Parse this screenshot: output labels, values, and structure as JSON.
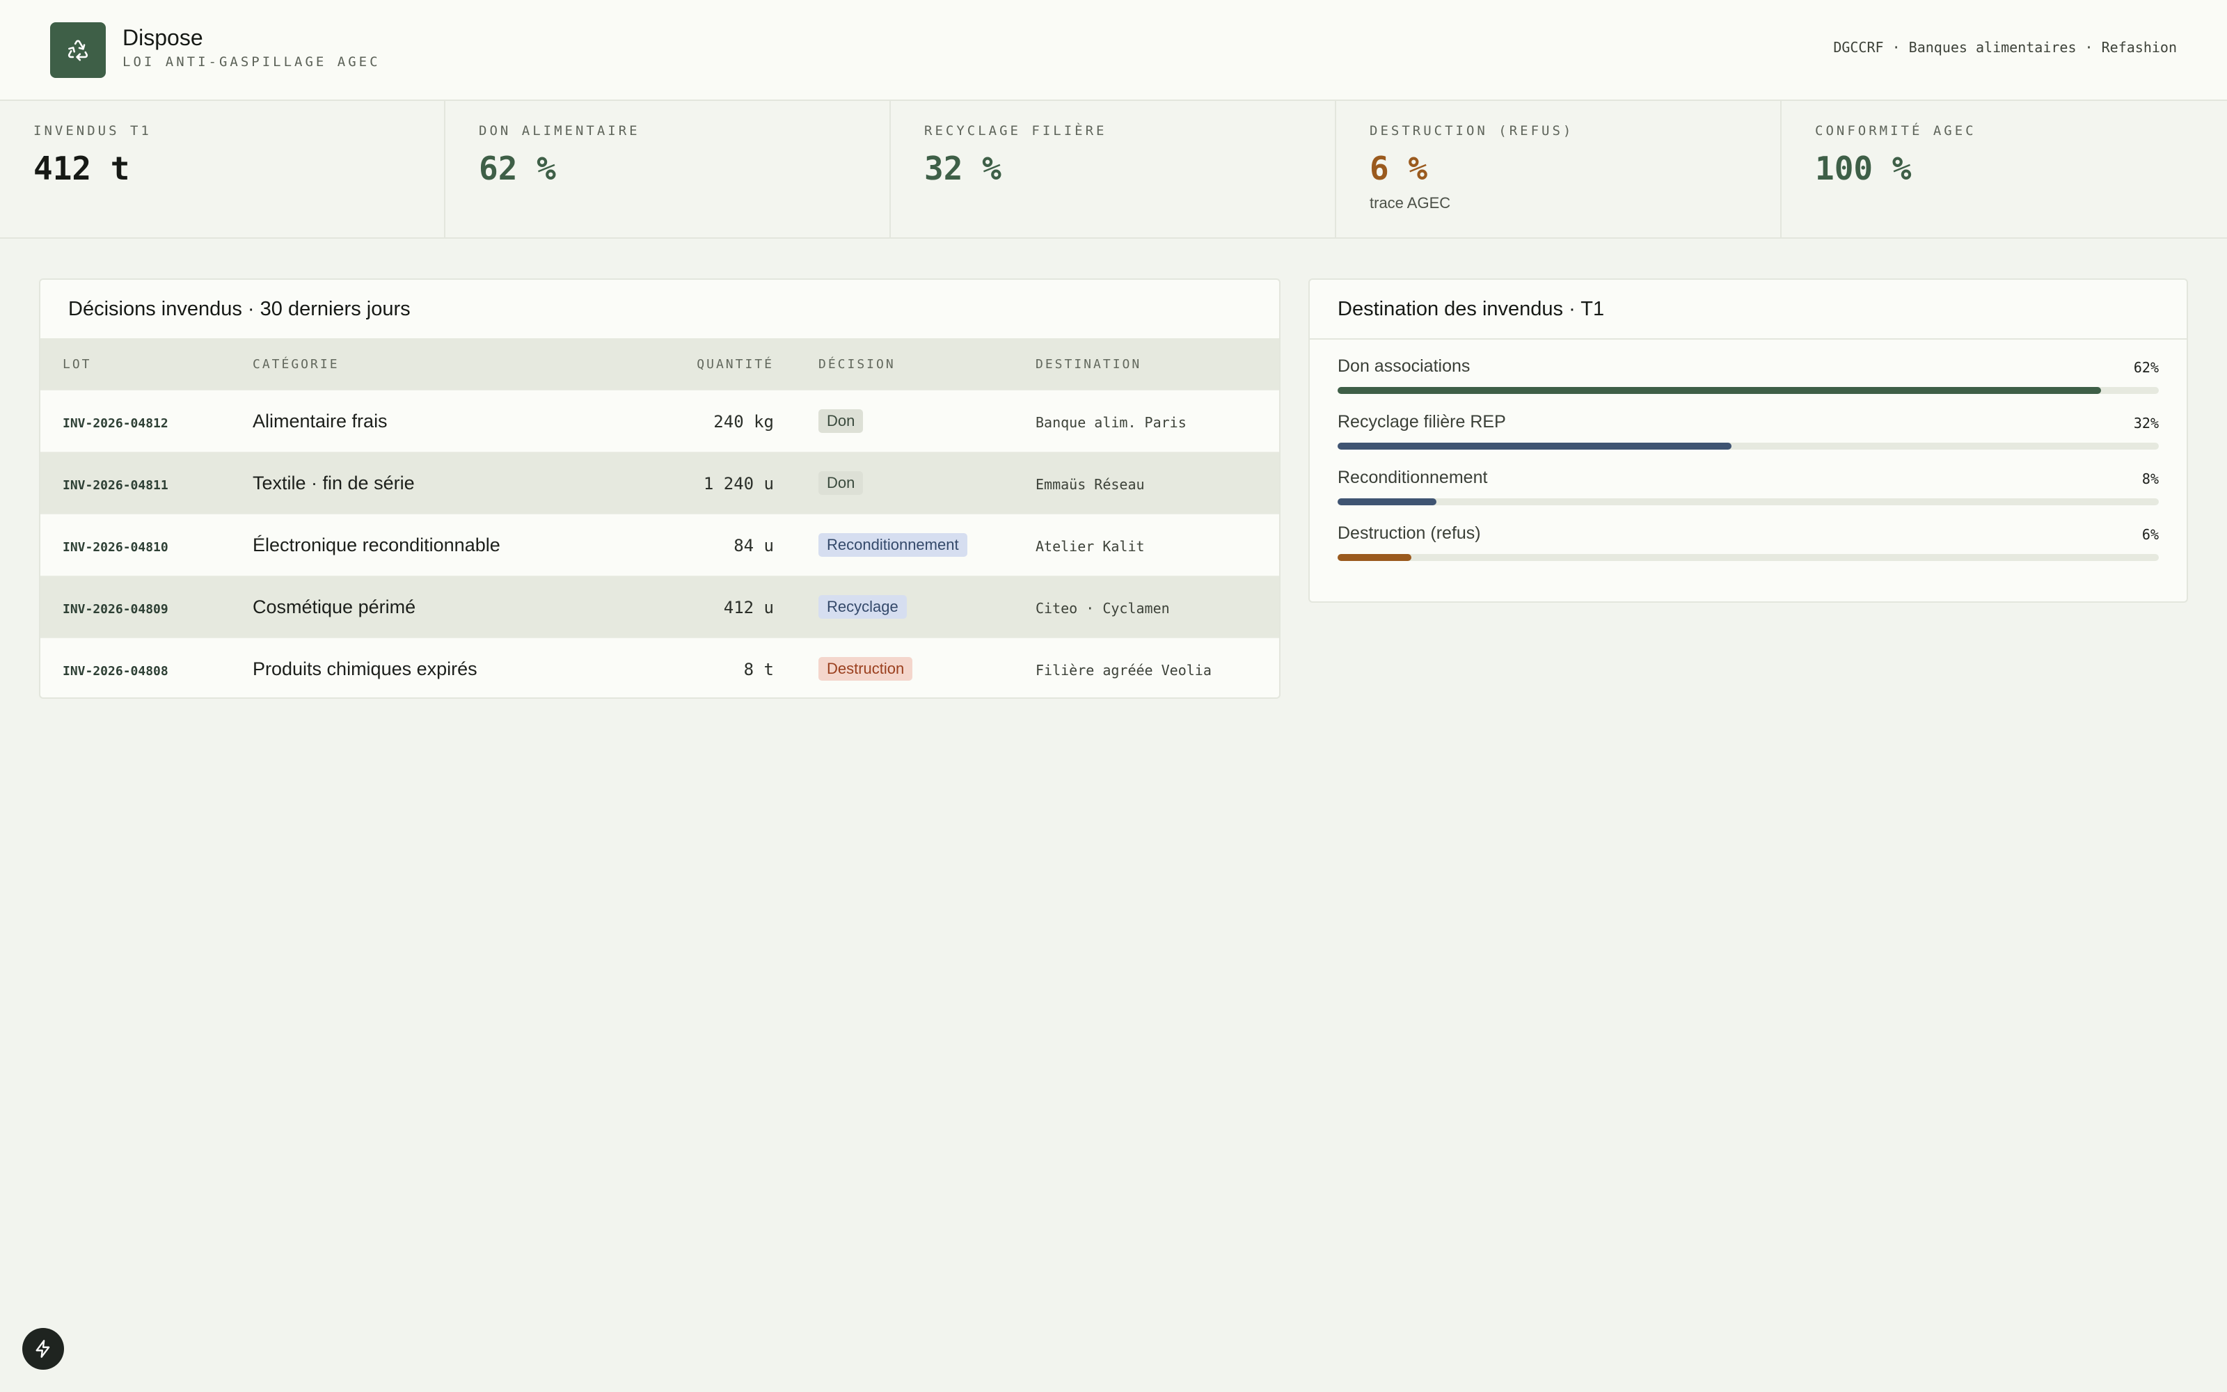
{
  "header": {
    "title": "Dispose",
    "subtitle": "LOI ANTI-GASPILLAGE AGEC",
    "logo_icon": "recycle-icon",
    "links": "DGCCRF · Banques alimentaires · Refashion"
  },
  "kpis": [
    {
      "label": "INVENDUS T1",
      "value": "412 t",
      "note": ""
    },
    {
      "label": "DON ALIMENTAIRE",
      "value": "62 %",
      "note": ""
    },
    {
      "label": "RECYCLAGE FILIÈRE",
      "value": "32 %",
      "note": ""
    },
    {
      "label": "DESTRUCTION (REFUS)",
      "value": "6 %",
      "note": "trace AGEC"
    },
    {
      "label": "CONFORMITÉ AGEC",
      "value": "100 %",
      "note": ""
    }
  ],
  "decisions": {
    "title": "Décisions invendus · 30 derniers jours",
    "columns": [
      "LOT",
      "CATÉGORIE",
      "QUANTITÉ",
      "DÉCISION",
      "DESTINATION"
    ],
    "rows": [
      {
        "lot": "INV-2026-04812",
        "category": "Alimentaire frais",
        "qty": "240 kg",
        "decision": "Don",
        "destination": "Banque alim. Paris"
      },
      {
        "lot": "INV-2026-04811",
        "category": "Textile · fin de série",
        "qty": "1 240 u",
        "decision": "Don",
        "destination": "Emmaüs Réseau"
      },
      {
        "lot": "INV-2026-04810",
        "category": "Électronique reconditionnable",
        "qty": "84 u",
        "decision": "Reconditionnement",
        "destination": "Atelier Kalit"
      },
      {
        "lot": "INV-2026-04809",
        "category": "Cosmétique périmé",
        "qty": "412 u",
        "decision": "Recyclage",
        "destination": "Citeo · Cyclamen"
      },
      {
        "lot": "INV-2026-04808",
        "category": "Produits chimiques expirés",
        "qty": "8 t",
        "decision": "Destruction",
        "destination": "Filière agréée Veolia"
      }
    ]
  },
  "destination": {
    "title": "Destination des invendus · T1",
    "items": [
      {
        "label": "Don associations",
        "pct_label": "62%",
        "fill": 0.93,
        "color": "#3e5f47"
      },
      {
        "label": "Recyclage filière REP",
        "pct_label": "32%",
        "fill": 0.48,
        "color": "#3f5472"
      },
      {
        "label": "Reconditionnement",
        "pct_label": "8%",
        "fill": 0.12,
        "color": "#3f5472"
      },
      {
        "label": "Destruction (refus)",
        "pct_label": "6%",
        "fill": 0.09,
        "color": "#9a5a1e"
      }
    ]
  },
  "fab_icon": "lightning-icon"
}
